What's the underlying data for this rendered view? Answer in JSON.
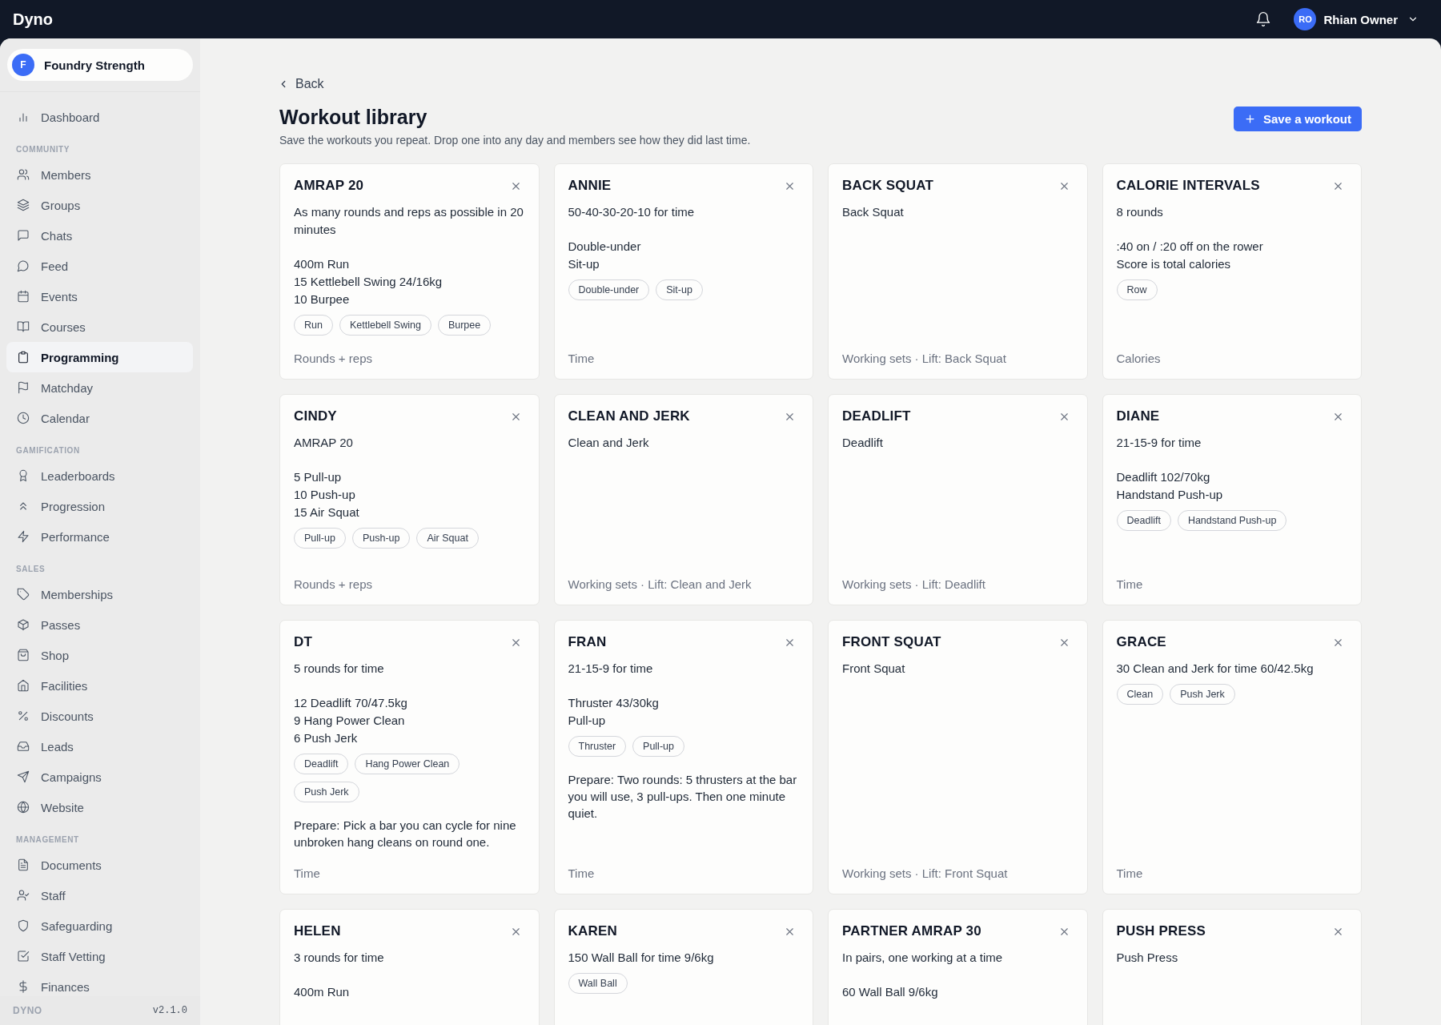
{
  "top_bar": {
    "brand": "Dyno",
    "user": {
      "initials": "RO",
      "name": "Rhian Owner"
    }
  },
  "sidebar": {
    "org": {
      "initial": "F",
      "name": "Foundry Strength"
    },
    "sections": [
      {
        "items": [
          {
            "label": "Dashboard",
            "selected": false
          }
        ]
      },
      {
        "heading": "COMMUNITY",
        "items": [
          {
            "label": "Members",
            "selected": false
          },
          {
            "label": "Groups",
            "selected": false
          },
          {
            "label": "Chats",
            "selected": false
          },
          {
            "label": "Feed",
            "selected": false
          },
          {
            "label": "Events",
            "selected": false
          },
          {
            "label": "Courses",
            "selected": false
          },
          {
            "label": "Programming",
            "selected": true
          },
          {
            "label": "Matchday",
            "selected": false
          },
          {
            "label": "Calendar",
            "selected": false
          }
        ]
      },
      {
        "heading": "GAMIFICATION",
        "items": [
          {
            "label": "Leaderboards",
            "selected": false
          },
          {
            "label": "Progression",
            "selected": false
          },
          {
            "label": "Performance",
            "selected": false
          }
        ]
      },
      {
        "heading": "SALES",
        "items": [
          {
            "label": "Memberships",
            "selected": false
          },
          {
            "label": "Passes",
            "selected": false
          },
          {
            "label": "Shop",
            "selected": false
          },
          {
            "label": "Facilities",
            "selected": false
          },
          {
            "label": "Discounts",
            "selected": false
          },
          {
            "label": "Leads",
            "selected": false
          },
          {
            "label": "Campaigns",
            "selected": false
          },
          {
            "label": "Website",
            "selected": false
          }
        ]
      },
      {
        "heading": "MANAGEMENT",
        "items": [
          {
            "label": "Documents",
            "selected": false
          },
          {
            "label": "Staff",
            "selected": false
          },
          {
            "label": "Safeguarding",
            "selected": false
          },
          {
            "label": "Staff Vetting",
            "selected": false
          },
          {
            "label": "Finances",
            "selected": false
          }
        ]
      }
    ],
    "footer": {
      "brand": "DYNO",
      "version": "v2.1.0"
    }
  },
  "page": {
    "back": "Back",
    "title": "Workout library",
    "subtitle": "Save the workouts you repeat. Drop one into any day and members see how they did last time.",
    "primary_button": "Save a workout"
  },
  "workouts": [
    {
      "name": "AMRAP 20",
      "blocks": [
        [
          "As many rounds and reps as possible in 20 minutes"
        ],
        [
          "400m Run",
          "15 Kettlebell Swing 24/16kg",
          "10 Burpee"
        ]
      ],
      "tags": [
        "Run",
        "Kettlebell Swing",
        "Burpee"
      ],
      "score": "Rounds + reps"
    },
    {
      "name": "ANNIE",
      "blocks": [
        [
          "50-40-30-20-10 for time"
        ],
        [
          "Double-under",
          "Sit-up"
        ]
      ],
      "tags": [
        "Double-under",
        "Sit-up"
      ],
      "score": "Time"
    },
    {
      "name": "BACK SQUAT",
      "blocks": [
        [
          "Back Squat"
        ]
      ],
      "score": "Working sets · Lift: Back Squat"
    },
    {
      "name": "CALORIE INTERVALS",
      "blocks": [
        [
          "8 rounds"
        ],
        [
          ":40 on / :20 off on the rower",
          "Score is total calories"
        ]
      ],
      "tags": [
        "Row"
      ],
      "score": "Calories"
    },
    {
      "name": "CINDY",
      "blocks": [
        [
          "AMRAP 20"
        ],
        [
          "5 Pull-up",
          "10 Push-up",
          "15 Air Squat"
        ]
      ],
      "tags": [
        "Pull-up",
        "Push-up",
        "Air Squat"
      ],
      "score": "Rounds + reps"
    },
    {
      "name": "CLEAN AND JERK",
      "blocks": [
        [
          "Clean and Jerk"
        ]
      ],
      "score": "Working sets · Lift: Clean and Jerk"
    },
    {
      "name": "DEADLIFT",
      "blocks": [
        [
          "Deadlift"
        ]
      ],
      "score": "Working sets · Lift: Deadlift"
    },
    {
      "name": "DIANE",
      "blocks": [
        [
          "21-15-9 for time"
        ],
        [
          "Deadlift 102/70kg",
          "Handstand Push-up"
        ]
      ],
      "tags": [
        "Deadlift",
        "Handstand Push-up"
      ],
      "score": "Time"
    },
    {
      "name": "DT",
      "blocks": [
        [
          "5 rounds for time"
        ],
        [
          "12 Deadlift 70/47.5kg",
          "9 Hang Power Clean",
          "6 Push Jerk"
        ]
      ],
      "tags": [
        "Deadlift",
        "Hang Power Clean",
        "Push Jerk"
      ],
      "note": "Prepare: Pick a bar you can cycle for nine unbroken hang cleans on round one.",
      "score": "Time"
    },
    {
      "name": "FRAN",
      "blocks": [
        [
          "21-15-9 for time"
        ],
        [
          "Thruster 43/30kg",
          "Pull-up"
        ]
      ],
      "tags": [
        "Thruster",
        "Pull-up"
      ],
      "note": "Prepare: Two rounds: 5 thrusters at the bar you will use, 3 pull-ups. Then one minute quiet.",
      "score": "Time"
    },
    {
      "name": "FRONT SQUAT",
      "blocks": [
        [
          "Front Squat"
        ]
      ],
      "score": "Working sets · Lift: Front Squat"
    },
    {
      "name": "GRACE",
      "blocks": [
        [
          "30 Clean and Jerk for time 60/42.5kg"
        ]
      ],
      "tags": [
        "Clean",
        "Push Jerk"
      ],
      "score": "Time"
    },
    {
      "name": "HELEN",
      "blocks": [
        [
          "3 rounds for time"
        ],
        [
          "400m Run"
        ]
      ]
    },
    {
      "name": "KAREN",
      "blocks": [
        [
          "150 Wall Ball for time 9/6kg"
        ]
      ],
      "tags": [
        "Wall Ball"
      ]
    },
    {
      "name": "PARTNER AMRAP 30",
      "blocks": [
        [
          "In pairs, one working at a time"
        ],
        [
          "60 Wall Ball 9/6kg"
        ]
      ]
    },
    {
      "name": "PUSH PRESS",
      "blocks": [
        [
          "Push Press"
        ]
      ]
    }
  ]
}
